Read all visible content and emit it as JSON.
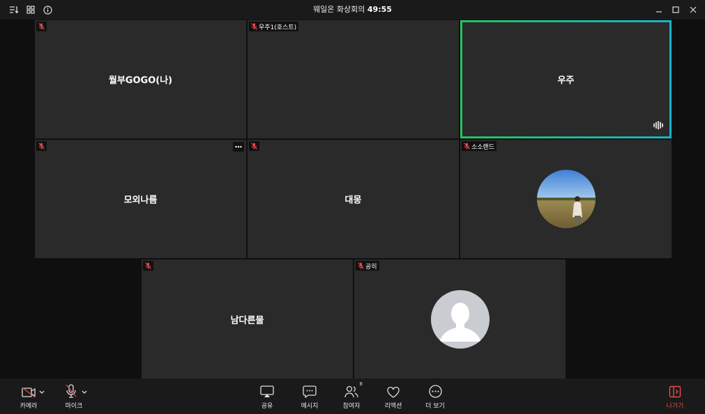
{
  "window": {
    "title": "웨일온 화상회의",
    "timer": "49:55"
  },
  "tiles": [
    {
      "name": "월부GOGO(나)",
      "label": ""
    },
    {
      "name": "",
      "label": "우주1(호스트)"
    },
    {
      "name": "우주",
      "label": ""
    },
    {
      "name": "모외나름",
      "label": ""
    },
    {
      "name": "대몽",
      "label": ""
    },
    {
      "name": "",
      "label": "소소랜드"
    },
    {
      "name": "남다른물",
      "label": ""
    },
    {
      "name": "",
      "label": "공히"
    }
  ],
  "toolbar": {
    "camera": "카메라",
    "mic": "마이크",
    "share": "공유",
    "message": "메시지",
    "participants": "참여자",
    "participants_count": "8",
    "reaction": "리액션",
    "more": "더 보기",
    "leave": "나가기"
  },
  "colors": {
    "active_border_start": "#22c55e",
    "active_border_end": "#19b3c9",
    "muted_red": "#e84a4a",
    "tile_bg": "#2a2a2a"
  }
}
